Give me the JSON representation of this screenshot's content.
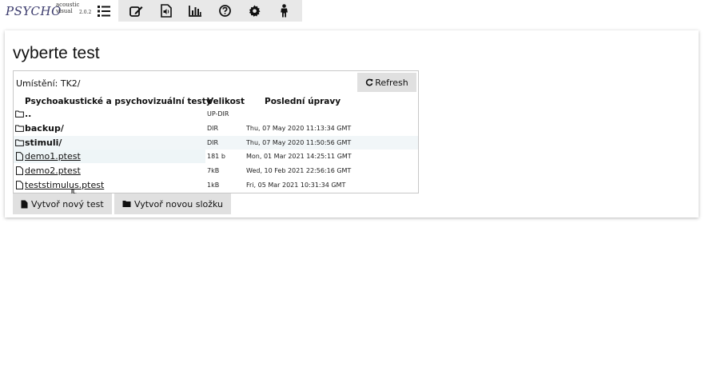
{
  "logo": {
    "main": "PSYCHO",
    "line1": "acoustic",
    "line2": "visual",
    "version": "2.0.2"
  },
  "toolbar": {
    "icons": [
      "list-icon",
      "edit-icon",
      "audio-file-icon",
      "bar-chart-icon",
      "help-icon",
      "gear-icon",
      "person-icon"
    ]
  },
  "page": {
    "title": "vyberte test"
  },
  "browser": {
    "location_label": "Umístění: TK2/",
    "refresh_label": "Refresh",
    "headers": {
      "name": "Psychoakustické a psychovizuální testy",
      "size": "Velikost",
      "modified": "Poslední úpravy"
    },
    "rows": [
      {
        "name": "..",
        "type": "dir",
        "size": "UP-DIR",
        "date": ""
      },
      {
        "name": "backup/",
        "type": "dir",
        "size": "DIR",
        "date": "Thu, 07 May 2020 11:13:34 GMT"
      },
      {
        "name": "stimuli/",
        "type": "dir",
        "size": "DIR",
        "date": "Thu, 07 May 2020 11:50:56 GMT"
      },
      {
        "name": "demo1.ptest",
        "type": "file",
        "size": "181 b",
        "date": "Mon, 01 Mar 2021 14:25:11 GMT"
      },
      {
        "name": "demo2.ptest",
        "type": "file",
        "size": "7kB",
        "date": "Wed, 10 Feb 2021 22:56:16 GMT"
      },
      {
        "name": "teststimulus.ptest",
        "type": "file",
        "size": "1kB",
        "date": "Fri, 05 Mar 2021 10:31:34 GMT"
      }
    ]
  },
  "actions": {
    "new_test": "Vytvoř nový test",
    "new_folder": "Vytvoř novou složku"
  }
}
